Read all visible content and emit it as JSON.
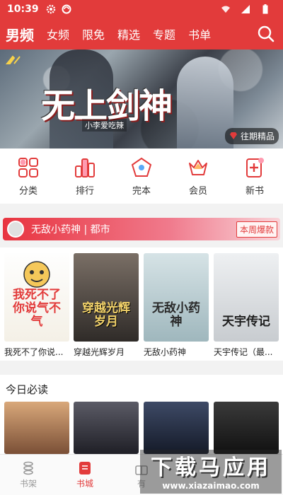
{
  "statusbar": {
    "time": "10:39"
  },
  "topnav": {
    "tabs": [
      {
        "label": "男频",
        "active": true
      },
      {
        "label": "女频"
      },
      {
        "label": "限免"
      },
      {
        "label": "精选"
      },
      {
        "label": "专题"
      },
      {
        "label": "书单"
      }
    ]
  },
  "banner": {
    "title": "无上剑神",
    "author": "小李爱吃辣",
    "badge": "往期精品"
  },
  "categories": [
    {
      "label": "分类",
      "icon": "grid-icon"
    },
    {
      "label": "排行",
      "icon": "ranking-icon"
    },
    {
      "label": "完本",
      "icon": "pentagon-icon"
    },
    {
      "label": "会员",
      "icon": "crown-icon"
    },
    {
      "label": "新书",
      "icon": "new-book-icon"
    }
  ],
  "hot": {
    "text": "无敌小药神 | 都市",
    "tag": "本周爆款"
  },
  "books": [
    {
      "name": "我死不了你说...",
      "cover_text": "我死不了你说气不气"
    },
    {
      "name": "穿越光辉岁月",
      "cover_text": "穿越光辉岁月"
    },
    {
      "name": "无敌小药神",
      "cover_text": "无敌小药神"
    },
    {
      "name": "天宇传记（最...",
      "cover_text": "天宇传记"
    }
  ],
  "daily": {
    "heading": "今日必读"
  },
  "bottombar": [
    {
      "label": "书架",
      "icon": "bookshelf-icon"
    },
    {
      "label": "书城",
      "icon": "bookstore-icon",
      "active": true
    },
    {
      "label": "有",
      "icon": "gift-icon"
    }
  ],
  "watermark": {
    "line1": "下载马应用",
    "line2": "www.xiazaimao.com"
  },
  "colors": {
    "accent": "#e23b3b"
  }
}
